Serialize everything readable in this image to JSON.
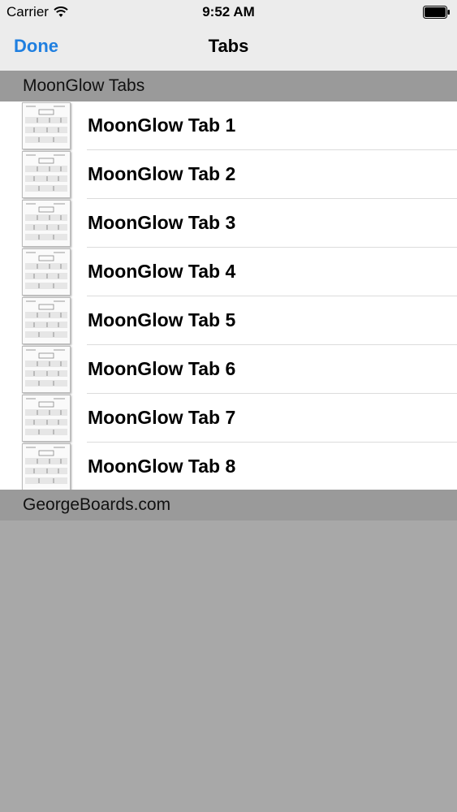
{
  "status_bar": {
    "carrier": "Carrier",
    "time": "9:52 AM",
    "wifi_icon": "wifi-icon",
    "battery_icon": "battery-icon"
  },
  "nav": {
    "done_label": "Done",
    "title": "Tabs"
  },
  "sections": {
    "top_header": "MoonGlow Tabs",
    "bottom_header": "GeorgeBoards.com"
  },
  "items": [
    {
      "label": "MoonGlow Tab 1"
    },
    {
      "label": "MoonGlow Tab 2"
    },
    {
      "label": "MoonGlow Tab 3"
    },
    {
      "label": "MoonGlow Tab 4"
    },
    {
      "label": "MoonGlow Tab 5"
    },
    {
      "label": "MoonGlow Tab 6"
    },
    {
      "label": "MoonGlow Tab 7"
    },
    {
      "label": "MoonGlow Tab 8"
    }
  ],
  "colors": {
    "accent": "#1f7fe0",
    "section_header_bg": "#9a9a9a",
    "page_bg": "#a8a8a8",
    "bar_bg": "#ececec"
  }
}
